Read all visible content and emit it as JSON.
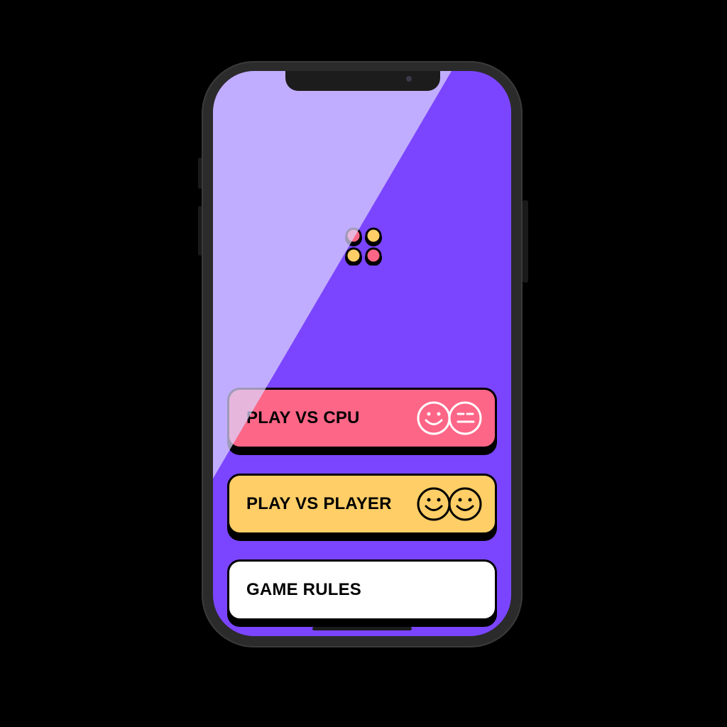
{
  "colors": {
    "screen_bg": "#7b45ff",
    "cpu_button": "#fd6687",
    "player_button": "#ffce67",
    "rules_button": "#ffffff",
    "outline": "#000000",
    "glare": "#c2b5ff",
    "logo_pink": "#fd6687",
    "logo_yellow": "#ffce67"
  },
  "logo": {
    "icon": "four-dots-logo-icon"
  },
  "menu": {
    "play_cpu": {
      "label": "PLAY VS CPU",
      "icon": "player-vs-cpu-faces-icon"
    },
    "play_player": {
      "label": "PLAY VS PLAYER",
      "icon": "player-vs-player-faces-icon"
    },
    "game_rules": {
      "label": "GAME RULES"
    }
  }
}
